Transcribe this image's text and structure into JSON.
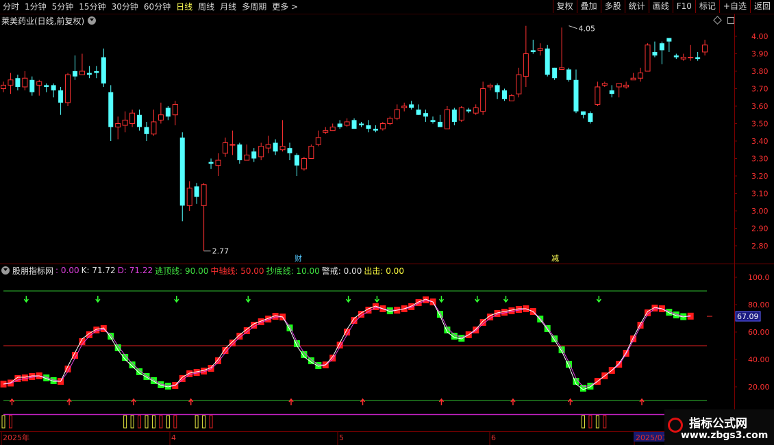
{
  "toolbar": {
    "periods": [
      "分时",
      "1分钟",
      "5分钟",
      "15分钟",
      "30分钟",
      "60分钟",
      "日线",
      "周线",
      "月线",
      "多周期",
      "更多 >"
    ],
    "active_period": "日线",
    "buttons": [
      "复权",
      "叠加",
      "多股",
      "统计",
      "画线",
      "F10",
      "标记",
      "+自选",
      "返回"
    ]
  },
  "stock": {
    "title": "莱美药业(日线,前复权)",
    "high_label": "4.05",
    "low_label": "2.77",
    "event_cai": "财",
    "event_jian": "减"
  },
  "price_axis": [
    "4.00",
    "3.90",
    "3.80",
    "3.70",
    "3.60",
    "3.50",
    "3.40",
    "3.30",
    "3.20",
    "3.10",
    "3.00",
    "2.90",
    "2.80"
  ],
  "indicator": {
    "name": "股朋指标网",
    "fields": [
      {
        "label": ": 0.00",
        "color": "#e040e0"
      },
      {
        "label": "K: 71.72",
        "color": "#e0e0e0"
      },
      {
        "label": "D: 71.22",
        "color": "#e040e0"
      },
      {
        "label": "逃顶线: 90.00",
        "color": "#40e040"
      },
      {
        "label": "中轴线: 50.00",
        "color": "#ff3030"
      },
      {
        "label": "抄底线: 10.00",
        "color": "#40e040"
      },
      {
        "label": "警戒: 0.00",
        "color": "#e0e0e0"
      },
      {
        "label": "出击: 0.00",
        "color": "#ffff40"
      }
    ],
    "current_value": "67.09",
    "axis": [
      "100.0",
      "80.00",
      "60.00",
      "40.00",
      "20.00"
    ]
  },
  "date_axis": [
    "2025年",
    "4",
    "5",
    "6",
    "2025/07"
  ],
  "watermark": {
    "title": "指标公式网",
    "url": "www.zbgs3.com"
  },
  "candles": [
    [
      3.7,
      3.72,
      3.68,
      3.74
    ],
    [
      3.72,
      3.75,
      3.67,
      3.79
    ],
    [
      3.76,
      3.71,
      3.69,
      3.78
    ],
    [
      3.71,
      3.76,
      3.69,
      3.8
    ],
    [
      3.75,
      3.68,
      3.66,
      3.77
    ],
    [
      3.72,
      3.74,
      3.66,
      3.75
    ],
    [
      3.72,
      3.71,
      3.68,
      3.73
    ],
    [
      3.72,
      3.69,
      3.65,
      3.73
    ],
    [
      3.69,
      3.62,
      3.55,
      3.71
    ],
    [
      3.62,
      3.78,
      3.6,
      3.79
    ],
    [
      3.8,
      3.77,
      3.75,
      3.89
    ],
    [
      3.78,
      3.8,
      3.78,
      3.9
    ],
    [
      3.79,
      3.78,
      3.76,
      3.83
    ],
    [
      3.8,
      3.79,
      3.76,
      3.83
    ],
    [
      3.88,
      3.73,
      3.71,
      3.93
    ],
    [
      3.68,
      3.48,
      3.4,
      3.72
    ],
    [
      3.48,
      3.5,
      3.41,
      3.54
    ],
    [
      3.49,
      3.52,
      3.45,
      3.57
    ],
    [
      3.5,
      3.56,
      3.48,
      3.58
    ],
    [
      3.55,
      3.48,
      3.46,
      3.58
    ],
    [
      3.48,
      3.44,
      3.4,
      3.51
    ],
    [
      3.44,
      3.51,
      3.43,
      3.58
    ],
    [
      3.52,
      3.55,
      3.5,
      3.62
    ],
    [
      3.59,
      3.54,
      3.52,
      3.6
    ],
    [
      3.55,
      3.61,
      3.49,
      3.63
    ],
    [
      3.42,
      3.03,
      2.94,
      3.45
    ],
    [
      3.03,
      3.13,
      3.0,
      3.17
    ],
    [
      3.14,
      3.08,
      3.04,
      3.16
    ],
    [
      3.03,
      3.15,
      2.77,
      3.16
    ],
    [
      3.28,
      3.27,
      3.24,
      3.3
    ],
    [
      3.26,
      3.29,
      3.2,
      3.33
    ],
    [
      3.33,
      3.39,
      3.31,
      3.42
    ],
    [
      3.38,
      3.38,
      3.32,
      3.46
    ],
    [
      3.38,
      3.29,
      3.27,
      3.39
    ],
    [
      3.29,
      3.32,
      3.29,
      3.38
    ],
    [
      3.34,
      3.3,
      3.28,
      3.36
    ],
    [
      3.31,
      3.37,
      3.29,
      3.39
    ],
    [
      3.36,
      3.38,
      3.33,
      3.43
    ],
    [
      3.39,
      3.34,
      3.32,
      3.41
    ],
    [
      3.35,
      3.37,
      3.34,
      3.52
    ],
    [
      3.36,
      3.33,
      3.29,
      3.39
    ],
    [
      3.32,
      3.26,
      3.2,
      3.33
    ],
    [
      3.24,
      3.3,
      3.23,
      3.31
    ],
    [
      3.3,
      3.37,
      3.3,
      3.38
    ],
    [
      3.38,
      3.42,
      3.37,
      3.46
    ],
    [
      3.45,
      3.46,
      3.44,
      3.48
    ],
    [
      3.46,
      3.48,
      3.47,
      3.5
    ],
    [
      3.5,
      3.48,
      3.47,
      3.52
    ],
    [
      3.49,
      3.51,
      3.48,
      3.53
    ],
    [
      3.52,
      3.47,
      3.47,
      3.53
    ],
    [
      3.5,
      3.49,
      3.48,
      3.51
    ],
    [
      3.49,
      3.47,
      3.45,
      3.52
    ],
    [
      3.47,
      3.46,
      3.45,
      3.49
    ],
    [
      3.47,
      3.5,
      3.46,
      3.51
    ],
    [
      3.5,
      3.53,
      3.49,
      3.54
    ],
    [
      3.53,
      3.58,
      3.52,
      3.61
    ],
    [
      3.59,
      3.6,
      3.57,
      3.62
    ],
    [
      3.61,
      3.59,
      3.58,
      3.63
    ],
    [
      3.58,
      3.55,
      3.55,
      3.61
    ],
    [
      3.56,
      3.54,
      3.51,
      3.58
    ],
    [
      3.52,
      3.51,
      3.5,
      3.54
    ],
    [
      3.51,
      3.48,
      3.48,
      3.55
    ],
    [
      3.47,
      3.58,
      3.47,
      3.6
    ],
    [
      3.58,
      3.51,
      3.49,
      3.59
    ],
    [
      3.52,
      3.59,
      3.51,
      3.6
    ],
    [
      3.58,
      3.57,
      3.56,
      3.59
    ],
    [
      3.56,
      3.59,
      3.55,
      3.61
    ],
    [
      3.57,
      3.7,
      3.55,
      3.74
    ],
    [
      3.71,
      3.72,
      3.69,
      3.73
    ],
    [
      3.72,
      3.68,
      3.64,
      3.73
    ],
    [
      3.69,
      3.64,
      3.63,
      3.7
    ],
    [
      3.63,
      3.66,
      3.63,
      3.67
    ],
    [
      3.67,
      3.78,
      3.65,
      3.82
    ],
    [
      3.77,
      3.9,
      3.71,
      4.06
    ],
    [
      3.92,
      3.91,
      3.9,
      3.98
    ],
    [
      3.92,
      3.93,
      3.89,
      3.96
    ],
    [
      3.93,
      3.78,
      3.77,
      3.95
    ],
    [
      3.82,
      3.76,
      3.75,
      3.82
    ],
    [
      3.81,
      3.82,
      3.81,
      4.05
    ],
    [
      3.81,
      3.75,
      3.74,
      3.82
    ],
    [
      3.75,
      3.57,
      3.56,
      3.81
    ],
    [
      3.57,
      3.55,
      3.53,
      3.57
    ],
    [
      3.56,
      3.51,
      3.5,
      3.57
    ],
    [
      3.61,
      3.71,
      3.6,
      3.74
    ],
    [
      3.72,
      3.73,
      3.71,
      3.74
    ],
    [
      3.69,
      3.67,
      3.65,
      3.72
    ],
    [
      3.71,
      3.73,
      3.65,
      3.73
    ],
    [
      3.71,
      3.72,
      3.7,
      3.74
    ],
    [
      3.75,
      3.76,
      3.75,
      3.79
    ],
    [
      3.76,
      3.79,
      3.74,
      3.82
    ],
    [
      3.8,
      3.95,
      3.8,
      3.96
    ],
    [
      3.91,
      3.89,
      3.88,
      3.97
    ],
    [
      3.96,
      3.92,
      3.84,
      3.97
    ],
    [
      3.99,
      3.97,
      3.91,
      3.99
    ],
    [
      3.89,
      3.88,
      3.87,
      3.9
    ],
    [
      3.87,
      3.88,
      3.86,
      3.9
    ],
    [
      3.88,
      3.88,
      3.86,
      3.95
    ],
    [
      3.88,
      3.87,
      3.86,
      3.91
    ],
    [
      3.91,
      3.95,
      3.89,
      3.98
    ]
  ],
  "kline": [
    22,
    23,
    27,
    27,
    28,
    28,
    26,
    24,
    24,
    35,
    45,
    55,
    59,
    62,
    63,
    56,
    47,
    40,
    35,
    30,
    27,
    24,
    21,
    20,
    21,
    27,
    30,
    31,
    32,
    34,
    40,
    48,
    53,
    58,
    62,
    66,
    68,
    70,
    72,
    71,
    62,
    50,
    42,
    38,
    35,
    36,
    42,
    52,
    62,
    70,
    74,
    77,
    79,
    77,
    75,
    76,
    77,
    79,
    82,
    84,
    82,
    72,
    60,
    56,
    55,
    58,
    62,
    68,
    72,
    74,
    75,
    76,
    77,
    77,
    75,
    69,
    62,
    54,
    46,
    35,
    22,
    18,
    20,
    24,
    28,
    32,
    37,
    45,
    56,
    66,
    75,
    78,
    77,
    74,
    72,
    71,
    72
  ],
  "dline": [
    22,
    22.5,
    25,
    26,
    27,
    28,
    27,
    25,
    24,
    31,
    41,
    51,
    57,
    61,
    62,
    58,
    50,
    43,
    37,
    32,
    28,
    25,
    22,
    21,
    21,
    25,
    29,
    30,
    31,
    33,
    38,
    45,
    51,
    56,
    60,
    64,
    67,
    69,
    71,
    71,
    64,
    53,
    45,
    40,
    36,
    36,
    40,
    49,
    58,
    67,
    72,
    75,
    78,
    77,
    76,
    76,
    77,
    78,
    81,
    83,
    82,
    74,
    63,
    58,
    56,
    58,
    61,
    66,
    70,
    73,
    74,
    75,
    76,
    77,
    75,
    70,
    63,
    56,
    48,
    38,
    26,
    20,
    21,
    24,
    28,
    32,
    36,
    44,
    54,
    64,
    73,
    77,
    77,
    75,
    73,
    71.5,
    71.2
  ],
  "tops": [
    3,
    13,
    24,
    34,
    48,
    52,
    61,
    66,
    70,
    83
  ],
  "bottoms": [
    1,
    9,
    18,
    26,
    40,
    50,
    61,
    71,
    79,
    89
  ]
}
